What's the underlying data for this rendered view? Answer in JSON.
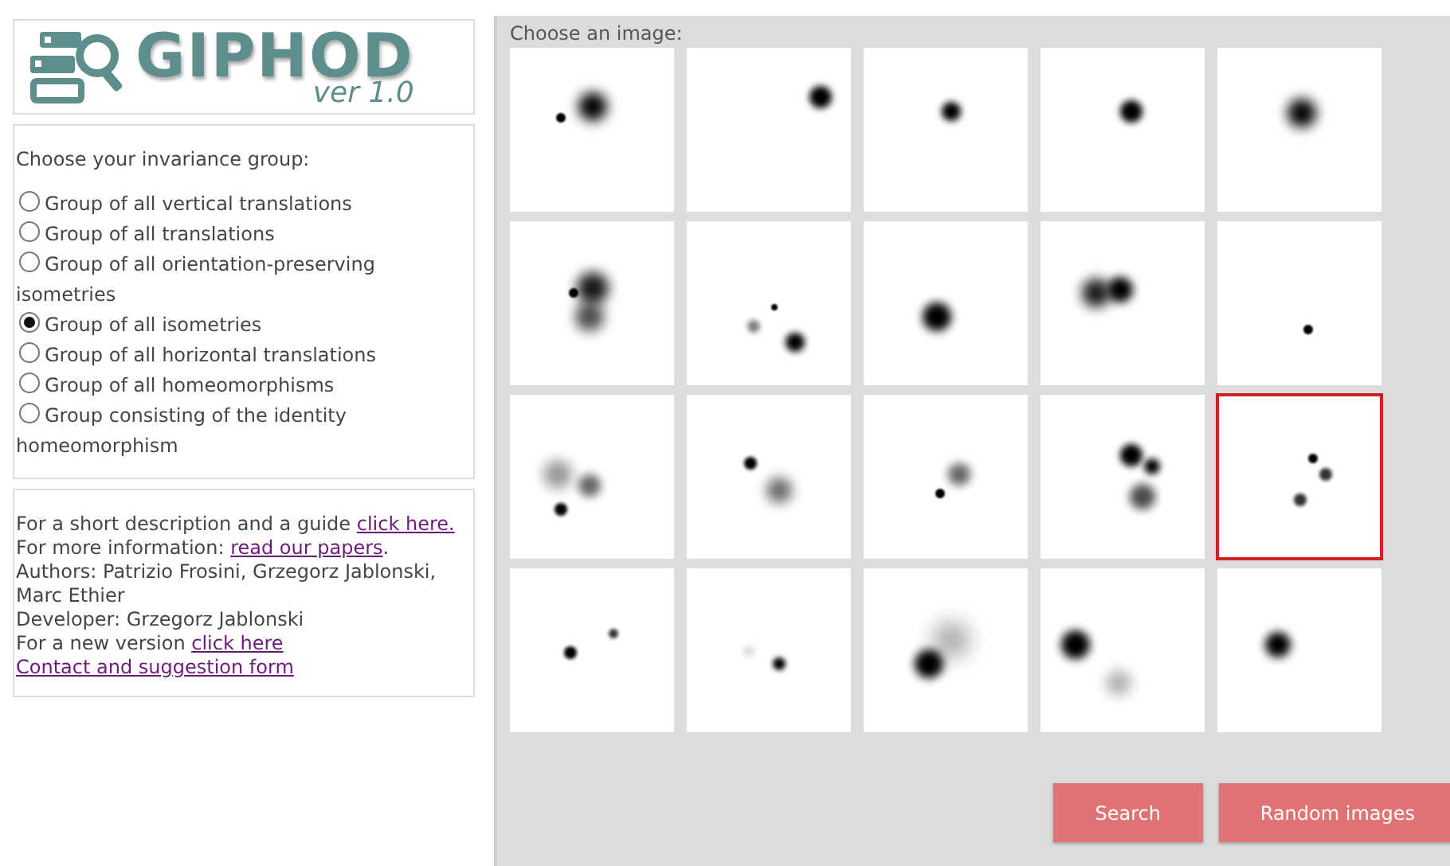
{
  "logo": {
    "title": "GIPHOD",
    "version": "ver 1.0"
  },
  "invariance": {
    "heading": "Choose your invariance group:",
    "options": [
      {
        "label": "Group of all vertical translations",
        "selected": false
      },
      {
        "label": "Group of all translations",
        "selected": false
      },
      {
        "label": "Group of all orientation-preserving isometries",
        "selected": false
      },
      {
        "label": "Group of all isometries",
        "selected": true
      },
      {
        "label": "Group of all horizontal translations",
        "selected": false
      },
      {
        "label": "Group of all homeomorphisms",
        "selected": false
      },
      {
        "label": "Group consisting of the identity homeomorphism",
        "selected": false
      }
    ]
  },
  "info": [
    {
      "text": "For a short description and a guide ",
      "link": "click here."
    },
    {
      "text": "For more information: ",
      "link": "read our papers",
      "after": "."
    },
    {
      "text": "Authors: Patrizio Frosini, Grzegorz Jablonski, Marc Ethier"
    },
    {
      "text": "Developer: Grzegorz Jablonski"
    },
    {
      "text": "For a new version ",
      "link": "click here"
    },
    {
      "link": "Contact and suggestion form"
    }
  ],
  "gallery": {
    "heading": "Choose an image:",
    "images": [
      {
        "selected": false
      },
      {
        "selected": false
      },
      {
        "selected": false
      },
      {
        "selected": false
      },
      {
        "selected": false
      },
      {
        "selected": false
      },
      {
        "selected": false
      },
      {
        "selected": false
      },
      {
        "selected": false
      },
      {
        "selected": false
      },
      {
        "selected": false
      },
      {
        "selected": false
      },
      {
        "selected": false
      },
      {
        "selected": false
      },
      {
        "selected": true
      },
      {
        "selected": false
      },
      {
        "selected": false
      },
      {
        "selected": false
      },
      {
        "selected": false
      },
      {
        "selected": false
      }
    ],
    "buttons": [
      "Search",
      "Random images"
    ]
  }
}
